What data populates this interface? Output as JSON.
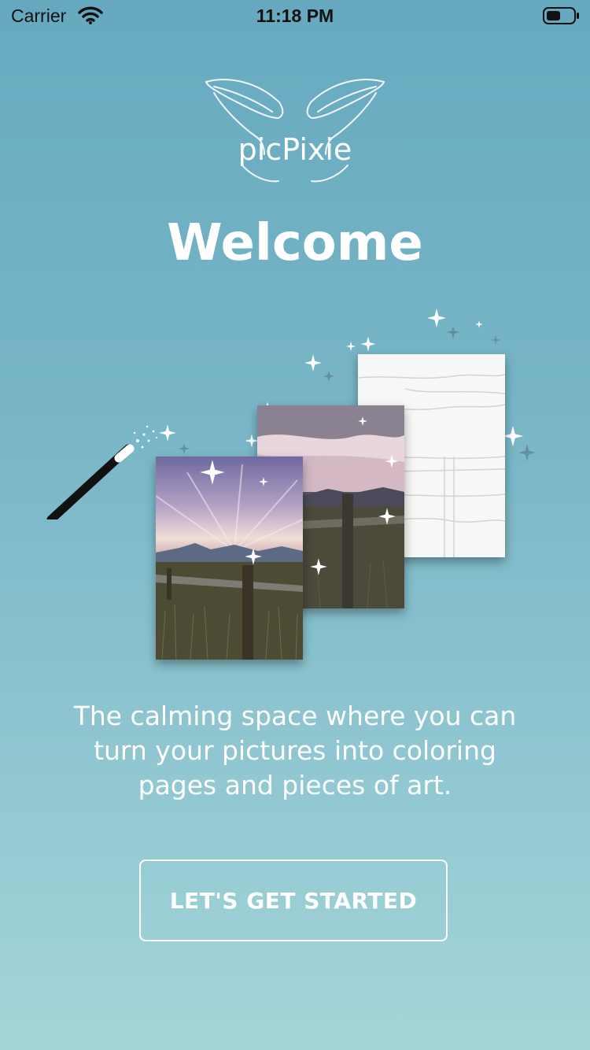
{
  "status_bar": {
    "carrier": "Carrier",
    "time": "11:18 PM",
    "icons": [
      "wifi-icon",
      "battery-icon"
    ]
  },
  "logo": {
    "text": "picPixie",
    "icon": "fairy-wings-logo"
  },
  "welcome": {
    "title": "Welcome"
  },
  "illustration": {
    "elements": [
      "magic-wand-icon",
      "sparkle-icon",
      "photo-card",
      "color-card",
      "sketch-card"
    ]
  },
  "tagline": "The calming space where you can turn your pictures into coloring pages and pieces of art.",
  "cta": {
    "label": "LET'S GET STARTED"
  },
  "colors": {
    "background_top": "#66a9bf",
    "background_bottom": "#a4d5d8",
    "text": "#ffffff"
  }
}
